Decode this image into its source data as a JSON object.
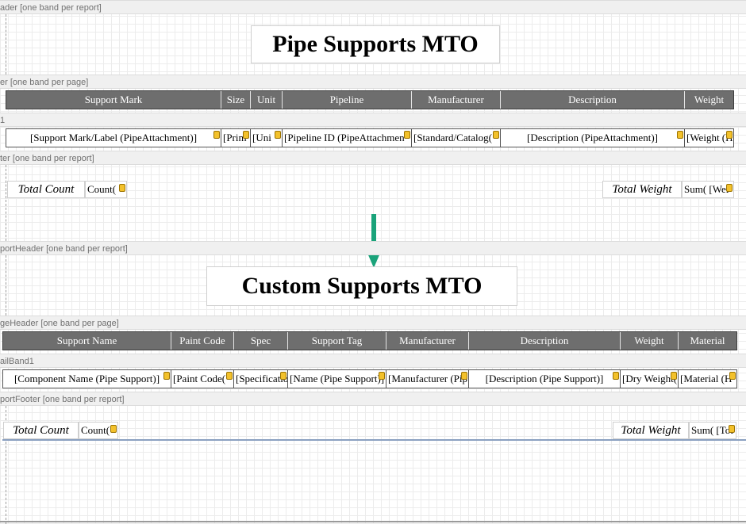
{
  "section1": {
    "report_header_label": "ader [one band per report]",
    "title": "Pipe Supports MTO",
    "page_header_label": "er [one band per page]",
    "columns": [
      "Support Mark",
      "Size",
      "Unit",
      "Pipeline",
      "Manufacturer",
      "Description",
      "Weight"
    ],
    "detail_label": "1",
    "detail_fields": [
      "[Support Mark/Label (PipeAttachment)]",
      "[Prim",
      "[Uni",
      "[Pipeline ID (PipeAttachmen",
      "[Standard/Catalog(",
      "[Description (PipeAttachment)]",
      "[Weight (H"
    ],
    "footer_label": "ter [one band per report]",
    "total_count_label": "Total Count",
    "count_field": "Count(",
    "total_weight_label": "Total Weight",
    "sum_field": "Sum( [Wei"
  },
  "section2": {
    "report_header_label": "portHeader [one band per report]",
    "title": "Custom Supports MTO",
    "page_header_label": "geHeader [one band per page]",
    "columns": [
      "Support Name",
      "Paint Code",
      "Spec",
      "Support Tag",
      "Manufacturer",
      "Description",
      "Weight",
      "Material"
    ],
    "detail_label": "ailBand1",
    "detail_fields": [
      "[Component Name (Pipe Support)]",
      "[Paint Code(",
      "[Specificatio",
      "[Name (Pipe Support)]",
      "[Manufacturer (Pip",
      "[Description (Pipe Support)]",
      "[Dry Weight(",
      "[Material (H"
    ],
    "footer_label": "portFooter [one band per report]",
    "total_count_label": "Total Count",
    "count_field": "Count(",
    "total_weight_label": "Total Weight",
    "sum_field": "Sum( [Tot"
  },
  "colors": {
    "header_fill": "#6e6e6e",
    "arrow": "#1aa37a",
    "tag_icon": "#f3c12b"
  },
  "icons": {
    "field": "expression-tag-icon",
    "transition": "arrow-down-icon"
  }
}
